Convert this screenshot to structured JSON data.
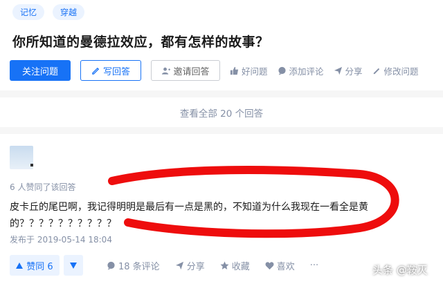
{
  "question": {
    "tags": [
      "记忆",
      "穿越"
    ],
    "title": "你所知道的曼德拉效应，都有怎样的故事？"
  },
  "actions": {
    "follow": "关注问题",
    "write": "写回答",
    "invite": "邀请回答",
    "good": "好问题",
    "comment": "添加评论",
    "share": "分享",
    "edit": "修改问题"
  },
  "view_all": "查看全部 20 个回答",
  "answer": {
    "voted_text": "6 人赞同了该回答",
    "content": "皮卡丘的尾巴啊，我记得明明是最后有一点是黑的，不知道为什么我现在一看全是黄的？？？？？？？？？？",
    "publish_time": "发布于 2019-05-14 18:04",
    "vote_up": "赞同 6",
    "comments": "18 条评论",
    "share": "分享",
    "favorite": "收藏",
    "like": "喜欢",
    "more": "···"
  },
  "colors": {
    "accent": "#1772f6",
    "muted": "#8590a6",
    "annotation": "#ee0d0d"
  },
  "watermark": "头条 @鞍灭"
}
